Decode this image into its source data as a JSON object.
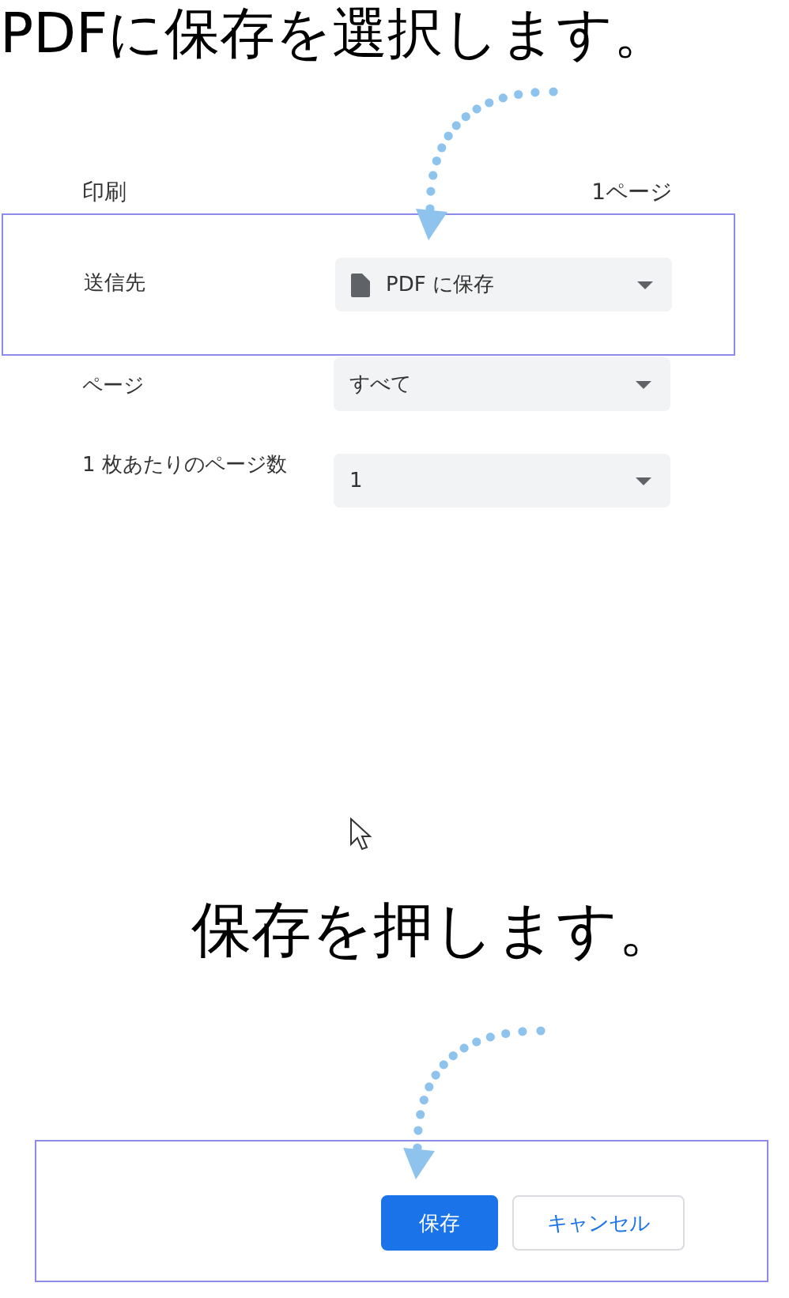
{
  "instruction_top": "PDFに保存を選択します。",
  "print_panel": {
    "title": "印刷",
    "page_count": "1ページ",
    "settings": [
      {
        "label": "送信先",
        "value": "PDF に保存",
        "kind": "destination"
      },
      {
        "label": "ページ",
        "value": "すべて",
        "kind": "select"
      },
      {
        "label": "1 枚あたりのページ数",
        "value": "1",
        "kind": "select"
      }
    ]
  },
  "instruction_bottom": "保存を押します。",
  "buttons": [
    {
      "label": "保存",
      "kind": "primary"
    },
    {
      "label": "キャンセル",
      "kind": "secondary"
    }
  ]
}
